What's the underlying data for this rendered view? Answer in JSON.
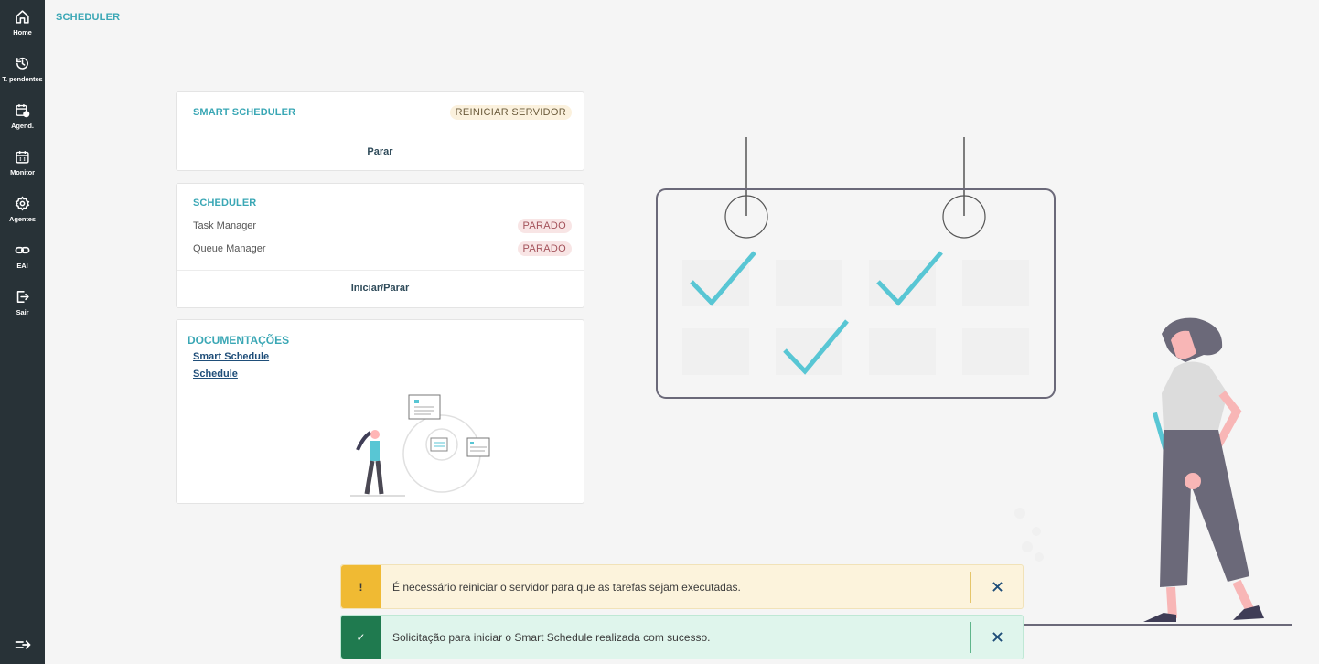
{
  "page": {
    "title": "SCHEDULER"
  },
  "sidebar": {
    "items": [
      {
        "label": "Home",
        "icon": "home-icon"
      },
      {
        "label": "T. pendentes",
        "icon": "history-icon"
      },
      {
        "label": "Agend.",
        "icon": "calendar-gear-icon"
      },
      {
        "label": "Monitor",
        "icon": "calendar-grid-icon"
      },
      {
        "label": "Agentes",
        "icon": "gear-icon"
      },
      {
        "label": "EAI",
        "icon": "link-icon"
      },
      {
        "label": "Sair",
        "icon": "logout-icon"
      }
    ],
    "collapse_icon": "collapse-arrow-icon"
  },
  "smart_scheduler": {
    "title": "SMART SCHEDULER",
    "restart_label": "REINICIAR SERVIDOR",
    "action_label": "Parar"
  },
  "scheduler": {
    "title": "SCHEDULER",
    "rows": [
      {
        "name": "Task Manager",
        "status": "PARADO"
      },
      {
        "name": "Queue Manager",
        "status": "PARADO"
      }
    ],
    "action_label": "Iniciar/Parar"
  },
  "docs": {
    "title": "DOCUMENTAÇÕES",
    "links": [
      "Smart Schedule",
      "Schedule"
    ]
  },
  "toasts": [
    {
      "type": "warning",
      "icon": "!",
      "message": "É necessário reiniciar o servidor para que as tarefas sejam executadas."
    },
    {
      "type": "success",
      "icon": "✓",
      "message": "Solicitação para iniciar o Smart Schedule realizada com sucesso."
    }
  ],
  "colors": {
    "sidebar_bg": "#283237",
    "accent": "#3aa7b5",
    "warning": "#f0ba33",
    "success": "#1f7a4f"
  }
}
